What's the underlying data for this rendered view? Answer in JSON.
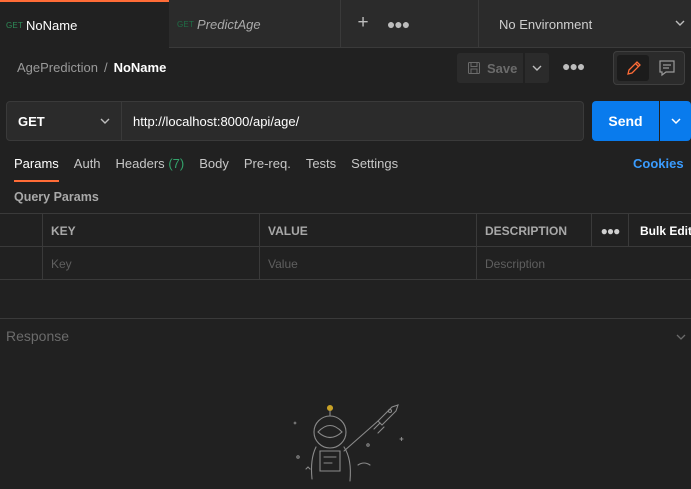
{
  "tabs": [
    {
      "method": "GET",
      "name": "NoName"
    },
    {
      "method": "GET",
      "name": "PredictAge"
    }
  ],
  "environment": "No Environment",
  "breadcrumb": {
    "collection": "AgePrediction",
    "separator": "/",
    "request": "NoName"
  },
  "save_label": "Save",
  "request": {
    "method": "GET",
    "url": "http://localhost:8000/api/age/",
    "send_label": "Send"
  },
  "request_tabs": {
    "params": "Params",
    "auth": "Auth",
    "headers": "Headers",
    "headers_count": "(7)",
    "body": "Body",
    "prereq": "Pre-req.",
    "tests": "Tests",
    "settings": "Settings",
    "cookies": "Cookies"
  },
  "query_params": {
    "title": "Query Params",
    "headers": {
      "key": "KEY",
      "value": "VALUE",
      "description": "DESCRIPTION",
      "bulk_edit": "Bulk Edit"
    },
    "placeholders": {
      "key": "Key",
      "value": "Value",
      "description": "Description"
    }
  },
  "response": {
    "title": "Response"
  },
  "colors": {
    "accent": "#ff6c37",
    "send": "#097bed",
    "link": "#3a9cff",
    "method_get": "#2e8b57"
  }
}
